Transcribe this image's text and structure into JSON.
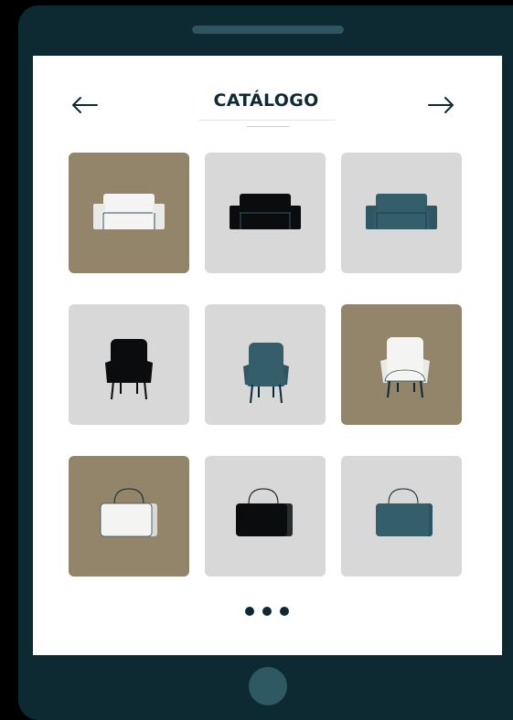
{
  "header": {
    "title": "CATÁLOGO",
    "back_icon": "arrow-left-icon",
    "forward_icon": "arrow-right-icon"
  },
  "catalog": {
    "items": [
      {
        "type": "sofa",
        "color": "white",
        "background": "taupe"
      },
      {
        "type": "sofa",
        "color": "black",
        "background": "gray"
      },
      {
        "type": "sofa",
        "color": "teal",
        "background": "gray"
      },
      {
        "type": "armchair",
        "color": "black",
        "background": "gray"
      },
      {
        "type": "armchair",
        "color": "teal",
        "background": "gray"
      },
      {
        "type": "armchair",
        "color": "white",
        "background": "taupe"
      },
      {
        "type": "bag",
        "color": "white",
        "background": "taupe"
      },
      {
        "type": "bag",
        "color": "black",
        "background": "gray"
      },
      {
        "type": "bag",
        "color": "teal",
        "background": "gray"
      }
    ]
  },
  "pagination": {
    "dot_count": 3
  },
  "colors": {
    "device_frame": "#0d2a33",
    "accent": "#0e2b33",
    "taupe": "#938569",
    "tile_gray": "#d8d8d8",
    "teal": "#345e6a",
    "black": "#0a0c0d",
    "white": "#f4f5f3"
  }
}
